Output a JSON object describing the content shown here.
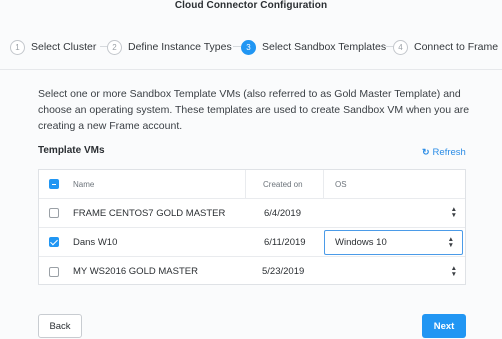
{
  "window": {
    "title": "Cloud Connector Configuration"
  },
  "steps": [
    {
      "number": "1",
      "label": "Select Cluster",
      "active": false
    },
    {
      "number": "2",
      "label": "Define Instance Types",
      "active": false
    },
    {
      "number": "3",
      "label": "Select Sandbox Templates",
      "active": true
    },
    {
      "number": "4",
      "label": "Connect to Frame",
      "active": false
    }
  ],
  "intro": "Select one or more Sandbox Template VMs (also referred to as Gold Master Template) and choose an operating system. These templates are used to create Sandbox VM when you are creating a new Frame account.",
  "section": {
    "title": "Template VMs",
    "refresh_label": "Refresh"
  },
  "table": {
    "columns": {
      "name": "Name",
      "created_on": "Created on",
      "os": "OS"
    },
    "rows": [
      {
        "name": "FRAME CENTOS7 GOLD MASTER",
        "created_on": "6/4/2019",
        "os": "",
        "checked": false
      },
      {
        "name": "Dans W10",
        "created_on": "6/11/2019",
        "os": "Windows 10",
        "checked": true
      },
      {
        "name": "MY WS2016 GOLD MASTER",
        "created_on": "5/23/2019",
        "os": "",
        "checked": false
      }
    ]
  },
  "footer": {
    "back_label": "Back",
    "next_label": "Next"
  },
  "colors": {
    "accent": "#2196f3",
    "text": "#2b2f33",
    "border": "#dfe2e6"
  }
}
